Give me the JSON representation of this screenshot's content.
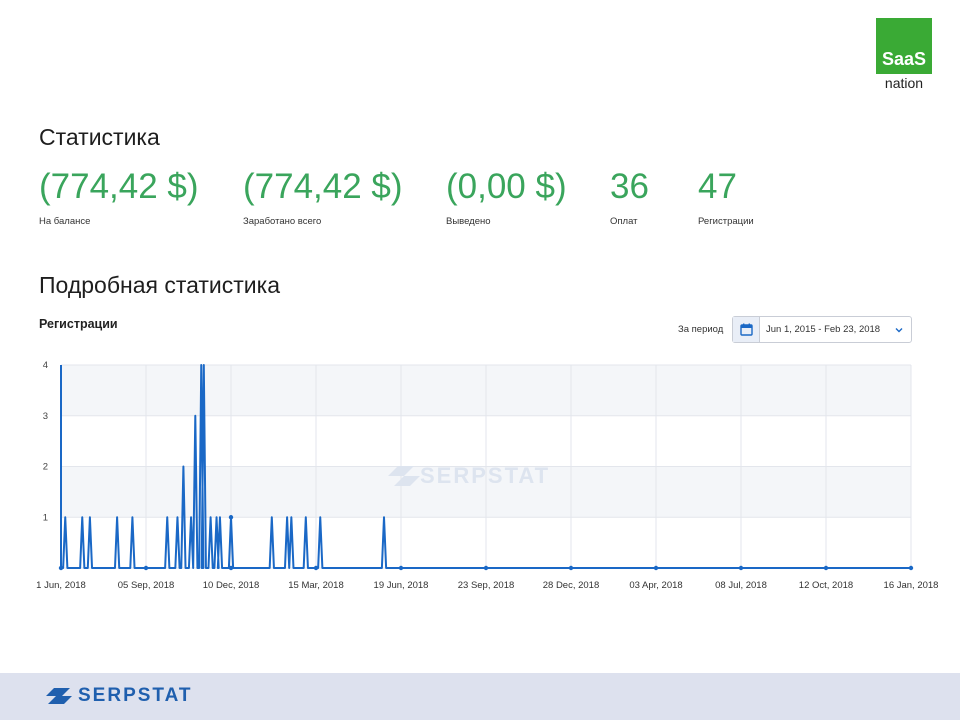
{
  "brand": {
    "badge_top": "SaaS",
    "badge_bottom": "nation",
    "badge_color": "#3aaa35"
  },
  "section1": {
    "title": "Статистика"
  },
  "stats": [
    {
      "value": "(774,42 $)",
      "label": "На балансе"
    },
    {
      "value": "(774,42 $)",
      "label": "Заработано всего"
    },
    {
      "value": "(0,00 $)",
      "label": "Выведено"
    },
    {
      "value": "36",
      "label": "Оплат"
    },
    {
      "value": "47",
      "label": "Регистрации"
    }
  ],
  "section2": {
    "title": "Подробная статистика"
  },
  "chart_header": {
    "title": "Регистрации",
    "period_label": "За период",
    "date_range": "Jun 1, 2015 - Feb 23, 2018",
    "icons": {
      "calendar": "calendar-icon",
      "dropdown": "chevron-down-icon"
    }
  },
  "watermark": "SERPSTAT",
  "footer": {
    "logo_text": "SERPSTAT"
  },
  "colors": {
    "stat_green": "#3aa55c",
    "line_blue": "#1a68c6",
    "footer_bg": "#dde1ee"
  },
  "chart_data": {
    "type": "line",
    "series_color": "#1a68c6",
    "ylim": [
      0,
      4
    ],
    "yticks": [
      "0",
      "1",
      "2",
      "3",
      "4"
    ],
    "grid": true,
    "xticks": [
      "1 Jun, 2018",
      "05 Sep, 2018",
      "10 Dec, 2018",
      "15 Mar, 2018",
      "19 Jun, 2018",
      "23 Sep, 2018",
      "28 Dec, 2018",
      "03 Apr, 2018",
      "08 Jul, 2018",
      "12 Oct, 2018",
      "16 Jan, 2018"
    ],
    "tick_fractions_note": "x values below are positions along the time axis expressed as index of the 0..10 tick scale",
    "spikes": [
      {
        "x": 0.05,
        "y": 1
      },
      {
        "x": 0.25,
        "y": 1
      },
      {
        "x": 0.34,
        "y": 1
      },
      {
        "x": 0.66,
        "y": 1
      },
      {
        "x": 0.84,
        "y": 1
      },
      {
        "x": 1.25,
        "y": 1
      },
      {
        "x": 1.37,
        "y": 1
      },
      {
        "x": 1.44,
        "y": 2
      },
      {
        "x": 1.53,
        "y": 1
      },
      {
        "x": 1.58,
        "y": 3
      },
      {
        "x": 1.65,
        "y": 4
      },
      {
        "x": 1.68,
        "y": 4
      },
      {
        "x": 1.76,
        "y": 1
      },
      {
        "x": 1.83,
        "y": 1
      },
      {
        "x": 1.87,
        "y": 1
      },
      {
        "x": 2.0,
        "y": 1
      },
      {
        "x": 2.48,
        "y": 1
      },
      {
        "x": 2.66,
        "y": 1
      },
      {
        "x": 2.71,
        "y": 1
      },
      {
        "x": 2.88,
        "y": 1
      },
      {
        "x": 3.05,
        "y": 1
      },
      {
        "x": 3.8,
        "y": 1
      }
    ],
    "markers": [
      0,
      1,
      2,
      3,
      4,
      5,
      6,
      7,
      8,
      9,
      10
    ]
  }
}
